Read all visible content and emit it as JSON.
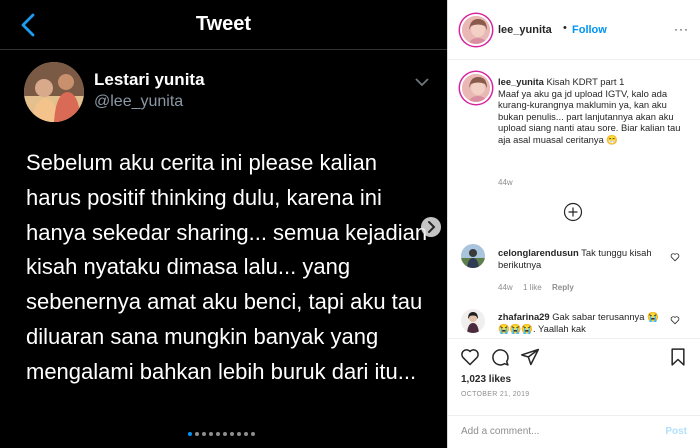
{
  "tweet": {
    "header_title": "Tweet",
    "author_name": "Lestari yunita",
    "author_handle": "@lee_yunita",
    "body": "Sebelum aku cerita ini please kalian harus positif thinking dulu, karena ini hanya sekedar sharing... semua kejadian kisah nyataku dimasa lalu... yang sebenernya amat aku benci, tapi aku tau diluaran sana mungkin banyak yang mengalami bahkan lebih buruk dari itu...",
    "icons": [
      "back-arrow-icon",
      "chevron-down-icon"
    ]
  },
  "carousel": {
    "dot_count": 10,
    "active_index": 0,
    "next_icon": "chevron-right-icon"
  },
  "post": {
    "username": "lee_yunita",
    "separator": "•",
    "follow_label": "Follow",
    "more_label": "···",
    "caption_user": "lee_yunita",
    "caption_text": " Kisah KDRT part 1\nMaaf ya aku ga jd upload IGTV, kalo ada kurang-kurangnya maklumin ya, kan aku bukan penulis... part lanjutannya akan aku upload siang nanti atau sore. Biar kalian tau aja asal muasal ceritanya 😁",
    "caption_time": "44w",
    "load_more_icon": "plus-circle-icon",
    "likes": "1,023 likes",
    "date": "OCTOBER 21, 2019",
    "add_comment_placeholder": "Add a comment...",
    "post_label": "Post"
  },
  "comments": [
    {
      "user": "celonglarendusun",
      "text": " Tak tunggu kisah berikutnya",
      "time": "44w",
      "likes": "1 like",
      "reply": "Reply"
    },
    {
      "user": "zhafarina29",
      "text": " Gak sabar terusannya 😭😭😭😭. Yaallah kak",
      "time": "",
      "likes": "",
      "reply": ""
    }
  ],
  "colors": {
    "accent": "#0095f6",
    "twitter_blue": "#1d9bf0",
    "dark_bg": "#000000"
  }
}
